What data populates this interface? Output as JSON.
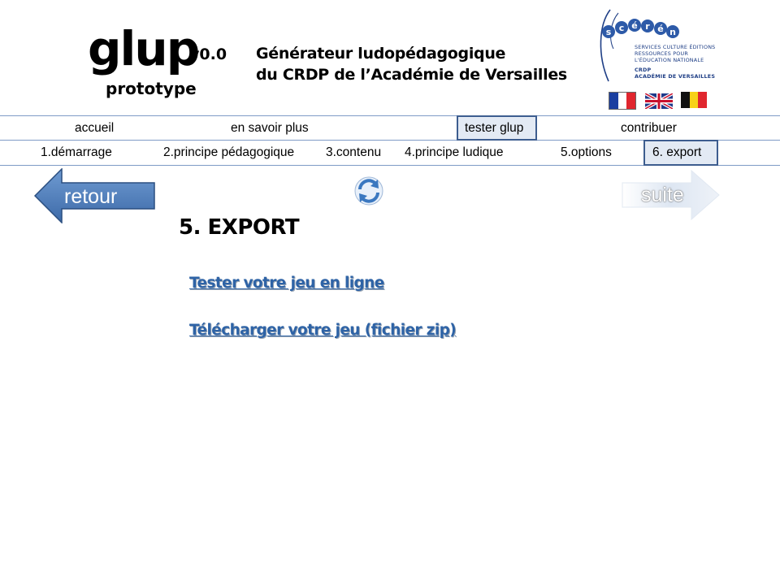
{
  "header": {
    "logo": "glup",
    "version": "v0.0",
    "subtitle": "prototype",
    "title_line1": "Générateur ludopédagogique",
    "title_line2": "du CRDP de l’Académie de Versailles"
  },
  "sceren": {
    "letters": [
      "s",
      "c",
      "é",
      "r",
      "é",
      "n"
    ],
    "line1": "SERVICES CULTURE ÉDITIONS",
    "line2": "RESSOURCES POUR",
    "line3": "L'ÉDUCATION NATIONALE",
    "line4": "CRDP",
    "line5": "ACADÉMIE DE VERSAILLES"
  },
  "flags": [
    "fr",
    "uk",
    "be"
  ],
  "nav_main": {
    "items": [
      {
        "label": "accueil"
      },
      {
        "label": "en savoir plus"
      },
      {
        "label": "tester glup",
        "active": true
      },
      {
        "label": "contribuer"
      }
    ]
  },
  "nav_steps": {
    "items": [
      {
        "label": "1.démarrage"
      },
      {
        "label": "2.principe pédagogique"
      },
      {
        "label": "3.contenu"
      },
      {
        "label": "4.principe ludique"
      },
      {
        "label": "5.options"
      },
      {
        "label": "6. export",
        "active": true
      }
    ]
  },
  "nav_arrows": {
    "back_label": "retour",
    "next_label": "suite"
  },
  "content": {
    "title": "5. EXPORT",
    "link_test": "Tester votre jeu en ligne",
    "link_download": "Télécharger votre jeu (fichier zip)"
  },
  "colors": {
    "nav_line": "#7f9bc6",
    "active_border": "#3d5d8f",
    "active_fill": "#e3eaf4",
    "arrow_blue": "#4f81bd",
    "link": "#2e63a6"
  }
}
